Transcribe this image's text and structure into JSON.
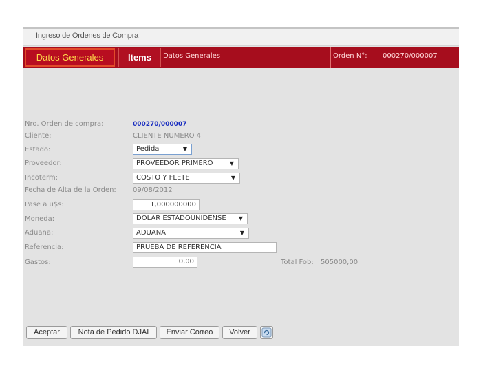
{
  "window": {
    "title": "Ingreso de Ordenes de Compra"
  },
  "tabs": {
    "general_label": "Datos Generales",
    "items_label": "Items",
    "section_title": "Datos Generales",
    "orden_label": "Orden N°:",
    "orden_value": "000270/000007"
  },
  "form": {
    "nro_orden": {
      "label": "Nro. Orden de compra:",
      "value": "000270/000007"
    },
    "cliente": {
      "label": "Cliente:",
      "value": "CLIENTE NUMERO 4"
    },
    "estado": {
      "label": "Estado:",
      "value": "Pedida"
    },
    "proveedor": {
      "label": "Proveedor:",
      "value": "PROVEEDOR PRIMERO"
    },
    "incoterm": {
      "label": "Incoterm:",
      "value": "COSTO Y FLETE"
    },
    "fecha_alta": {
      "label": "Fecha de Alta de la Orden:",
      "value": "09/08/2012"
    },
    "pase_uss": {
      "label": "Pase a u$s:",
      "value": "1,000000000"
    },
    "moneda": {
      "label": "Moneda:",
      "value": "DOLAR ESTADOUNIDENSE"
    },
    "aduana": {
      "label": "Aduana:",
      "value": "ADUANA"
    },
    "referencia": {
      "label": "Referencia:",
      "value": "PRUEBA DE REFERENCIA"
    },
    "gastos": {
      "label": "Gastos:",
      "value": "0,00"
    },
    "total_fob": {
      "label": "Total Fob:",
      "value": "505000,00"
    }
  },
  "buttons": {
    "aceptar": "Aceptar",
    "nota_pedido": "Nota de Pedido DJAI",
    "enviar_correo": "Enviar Correo",
    "volver": "Volver"
  },
  "icons": {
    "refresh": "refresh-icon",
    "dropdown": "chevron-down-icon"
  },
  "colors": {
    "accent": "#a60d1d",
    "tab_text": "#ffd84a",
    "order_number": "#1a2ec0"
  }
}
